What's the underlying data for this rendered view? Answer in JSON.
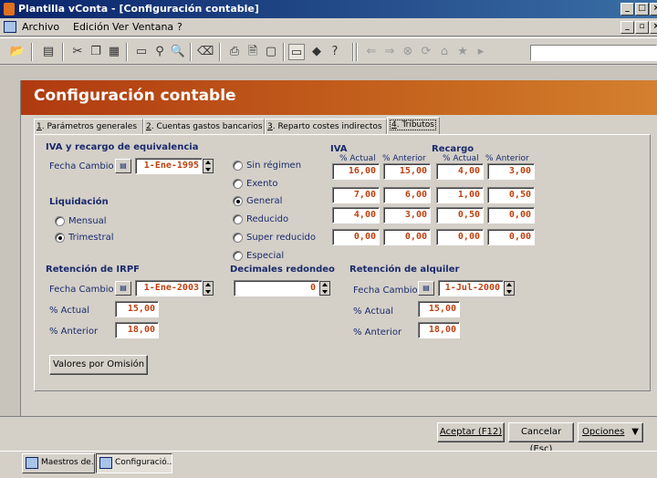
{
  "window": {
    "title": "Plantilla vConta - [Configuración contable]"
  },
  "menu": [
    "Archivo",
    "Edición",
    "Ver",
    "Ventana",
    "?"
  ],
  "document": {
    "title": "Configuración contable"
  },
  "tabs": [
    {
      "num": "1",
      "label": ". Parámetros generales"
    },
    {
      "num": "2",
      "label": ". Cuentas gastos bancarios"
    },
    {
      "num": "3",
      "label": ". Reparto costes indirectos"
    },
    {
      "num": "4",
      "label": ". Tributos"
    }
  ],
  "iva_section": {
    "title": "IVA y recargo de equivalencia",
    "fecha_label": "Fecha Cambio",
    "fecha_value": "1-Ene-1995",
    "regimes": [
      "Sin régimen",
      "Exento",
      "General",
      "Reducido",
      "Super reducido",
      "Especial"
    ],
    "selected_regime": "General",
    "iva_header": "IVA",
    "recargo_header": "Recargo",
    "col_actual": "% Actual",
    "col_anterior": "% Anterior",
    "rows": [
      {
        "iva_actual": "16,00",
        "iva_anterior": "15,00",
        "rec_actual": "4,00",
        "rec_anterior": "3,00"
      },
      {
        "iva_actual": "7,00",
        "iva_anterior": "6,00",
        "rec_actual": "1,00",
        "rec_anterior": "0,50"
      },
      {
        "iva_actual": "4,00",
        "iva_anterior": "3,00",
        "rec_actual": "0,50",
        "rec_anterior": "0,00"
      },
      {
        "iva_actual": "0,00",
        "iva_anterior": "0,00",
        "rec_actual": "0,00",
        "rec_anterior": "0,00"
      }
    ]
  },
  "liquidacion": {
    "title": "Liquidación",
    "options": [
      "Mensual",
      "Trimestral"
    ],
    "selected": "Trimestral"
  },
  "irpf": {
    "title": "Retención de IRPF",
    "fecha_label": "Fecha Cambio",
    "fecha_value": "1-Ene-2003",
    "actual_label": "% Actual",
    "actual_value": "15,00",
    "anterior_label": "% Anterior",
    "anterior_value": "18,00"
  },
  "decimales": {
    "title": "Decimales redondeo",
    "value": "0"
  },
  "alquiler": {
    "title": "Retención de alquiler",
    "fecha_label": "Fecha Cambio",
    "fecha_value": "1-Jul-2000",
    "actual_label": "% Actual",
    "actual_value": "15,00",
    "anterior_label": "% Anterior",
    "anterior_value": "18,00"
  },
  "buttons": {
    "defaults": "Valores por Omisión",
    "accept": "Aceptar (F12)",
    "cancel": "Cancelar (Esc)",
    "options": "Opciones"
  },
  "taskbar": [
    "Maestros de...",
    "Configuració..."
  ]
}
